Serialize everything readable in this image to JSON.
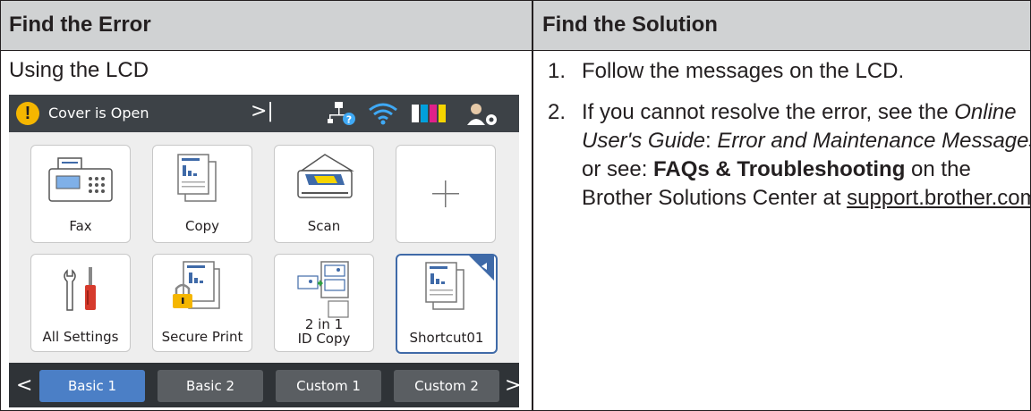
{
  "table": {
    "col1_header": "Find the Error",
    "col2_header": "Find the Solution",
    "col1_intro": "Using the LCD"
  },
  "lcd": {
    "status_text": "Cover is Open",
    "warning_glyph": "!",
    "next_glyph": ">|",
    "tiles": [
      {
        "label": "Fax"
      },
      {
        "label": "Copy"
      },
      {
        "label": "Scan"
      },
      {
        "label": ""
      },
      {
        "label": "All Settings"
      },
      {
        "label": "Secure Print"
      },
      {
        "label": "2 in 1"
      },
      {
        "label": "Shortcut01"
      }
    ],
    "tile_id_copy_line2": "ID Copy",
    "tabs": [
      "Basic 1",
      "Basic 2",
      "Custom 1",
      "Custom 2"
    ],
    "tab_prev": "<",
    "tab_next": ">",
    "accent_color": "#4b7fc6",
    "warning_color": "#f5b600",
    "wifi_color": "#3fa9f5"
  },
  "solution": {
    "item1_num": "1.",
    "item1_text": "Follow the messages on the LCD.",
    "item2_num": "2.",
    "item2_p1": "If you cannot resolve the error, see the",
    "item2_guide": "Online User's Guide",
    "item2_colon": ": ",
    "item2_topic": "Error and Maintenance Messages",
    "item2_p2": " or see: ",
    "item2_faq": "FAQs & Troubleshooting",
    "item2_p3": " on the Brother Solutions Center at ",
    "item2_link": "support.brother.com",
    "item2_end": "."
  },
  "colors": {
    "header_bg": "#d0d2d3",
    "rule": "#231f20"
  }
}
